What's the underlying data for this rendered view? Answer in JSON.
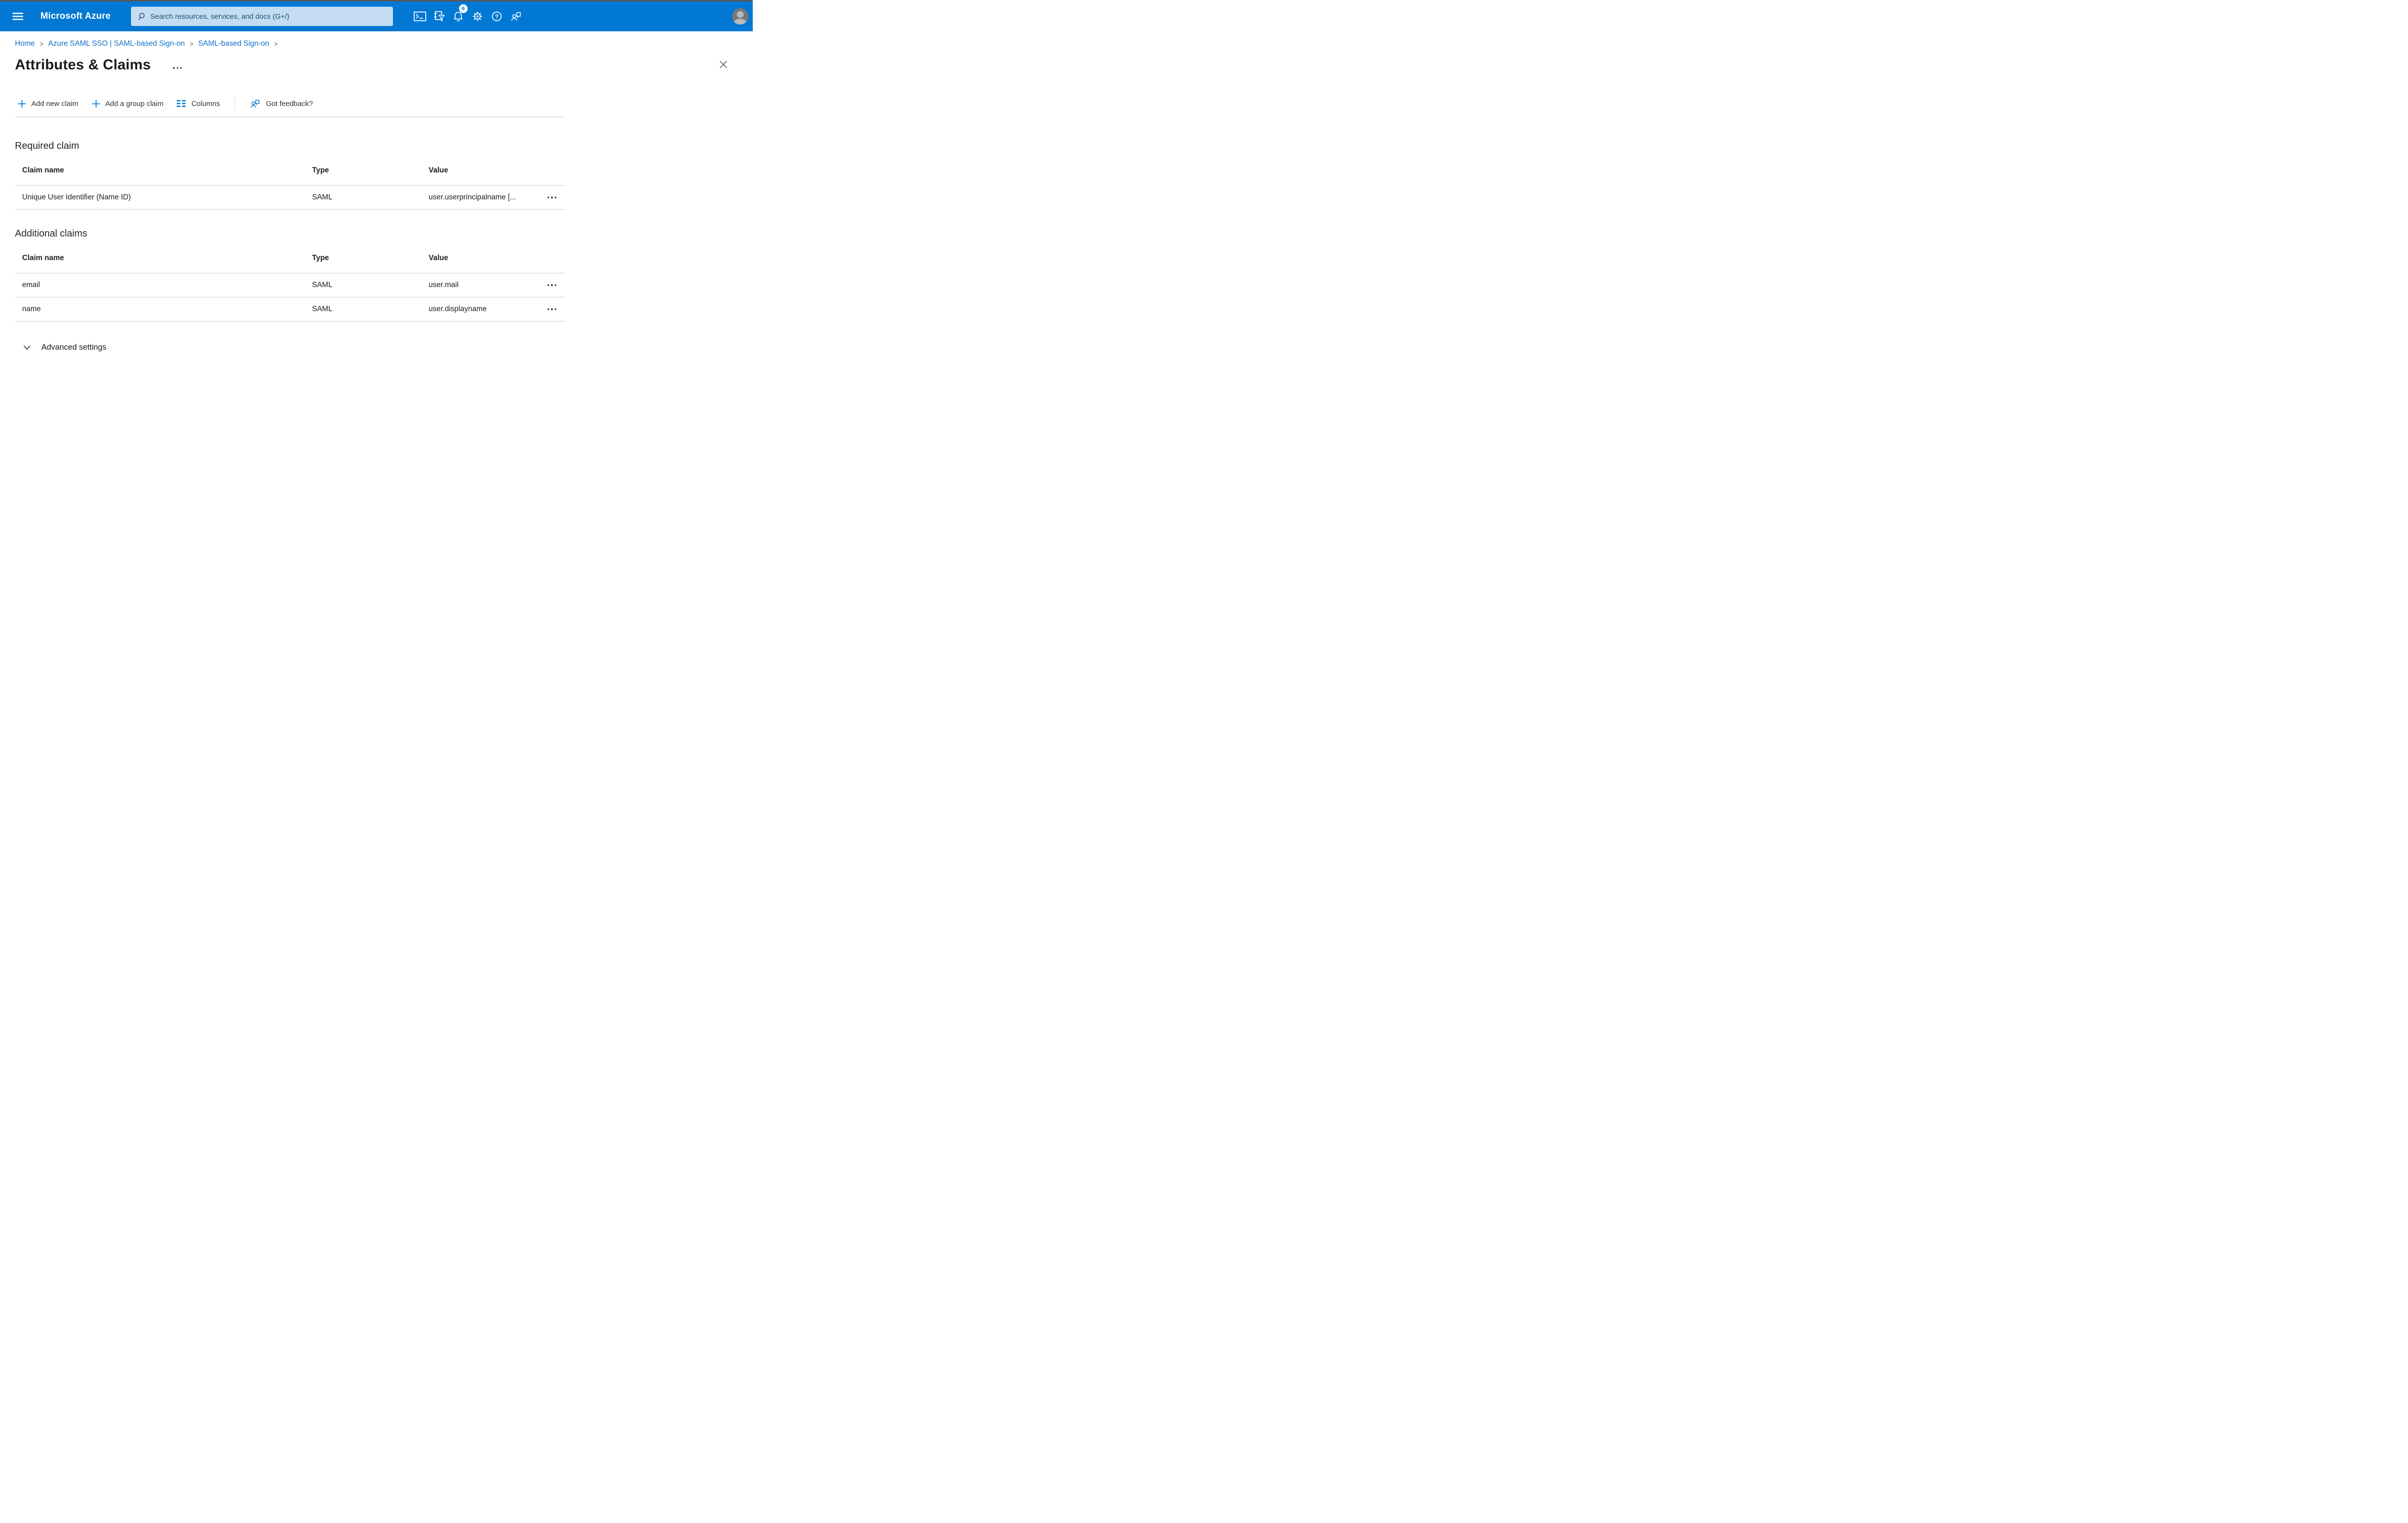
{
  "window": {
    "top_edge_color": "#58595b"
  },
  "header": {
    "brand": "Microsoft Azure",
    "search_placeholder": "Search resources, services, and docs (G+/)",
    "notification_count": "6",
    "colors": {
      "bar_bg": "#0078d4",
      "search_bg": "#c4dcf1",
      "search_text": "#1c4f74"
    }
  },
  "breadcrumb": {
    "separator": ">",
    "items": [
      "Home",
      "Azure SAML SSO | SAML-based Sign-on",
      "SAML-based Sign-on"
    ]
  },
  "page": {
    "title": "Attributes & Claims"
  },
  "toolbar": {
    "add_new_claim": "Add new claim",
    "add_group_claim": "Add a group claim",
    "columns": "Columns",
    "got_feedback": "Got feedback?"
  },
  "required_claim": {
    "heading": "Required claim",
    "columns": [
      "Claim name",
      "Type",
      "Value"
    ],
    "rows": [
      {
        "claim_name": "Unique User Identifier (Name ID)",
        "type": "SAML",
        "value": "user.userprincipalname [..."
      }
    ]
  },
  "additional_claims": {
    "heading": "Additional claims",
    "columns": [
      "Claim name",
      "Type",
      "Value"
    ],
    "rows": [
      {
        "claim_name": "email",
        "type": "SAML",
        "value": "user.mail"
      },
      {
        "claim_name": "name",
        "type": "SAML",
        "value": "user.displayname"
      }
    ]
  },
  "advanced_settings": {
    "label": "Advanced settings"
  },
  "colors": {
    "accent": "#0078d4",
    "link": "#1070c6",
    "text": "#201f1e",
    "divider": "#e4e4e4"
  }
}
